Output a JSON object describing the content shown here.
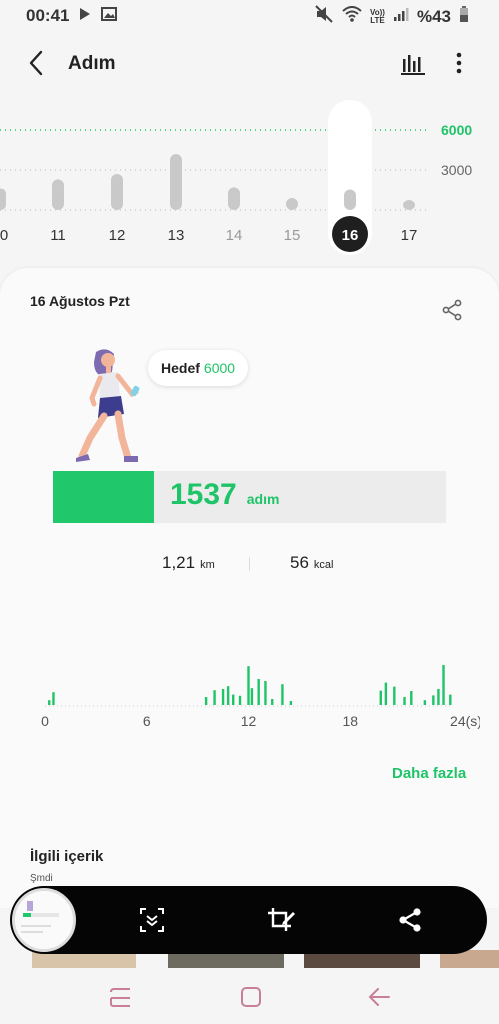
{
  "status_bar": {
    "time": "00:41",
    "network_top": "Vo))",
    "network_bottom": "LTE",
    "battery": "%43",
    "icons": [
      "play-icon",
      "gallery-icon",
      "mute-icon",
      "wifi-icon",
      "volte-icon",
      "signal-icon",
      "battery-icon"
    ]
  },
  "header": {
    "title": "Adım",
    "icons": [
      "back-arrow-icon",
      "bar-chart-icon",
      "more-vert-icon"
    ]
  },
  "day_chart": {
    "goal_label": "6000",
    "mid_label": "3000",
    "days": [
      "0",
      "11",
      "12",
      "13",
      "14",
      "15",
      "16",
      "17"
    ],
    "steps": [
      1600,
      2300,
      2700,
      4200,
      1700,
      900,
      1537,
      0
    ],
    "selected_day": "16",
    "ymax": 6000,
    "colors": {
      "goal": "#1fc468",
      "bar": "#c9c9c9",
      "selected": "#1f1f1f"
    }
  },
  "card": {
    "date": "16 Ağustos Pzt",
    "goal_prefix": "Hedef",
    "goal_value": "6000",
    "steps_value": "1537",
    "steps_unit": "adım",
    "progress": 0.256,
    "distance_value": "1,21",
    "distance_unit": "km",
    "calories_value": "56",
    "calories_unit": "kcal",
    "more_link": "Daha fazla",
    "related_title": "İlgili içerik",
    "related_sub": "Şmdi",
    "accent": "#1fc468"
  },
  "chart_data": {
    "type": "bar",
    "title": "",
    "xlabel": "",
    "ylabel": "",
    "x_ticks": [
      "0",
      "6",
      "12",
      "18",
      "24(s)"
    ],
    "xlim": [
      0,
      24
    ],
    "ylim": [
      0,
      1
    ],
    "x": [
      0.25,
      0.5,
      9.5,
      10.0,
      10.5,
      10.8,
      11.1,
      11.5,
      12.0,
      12.2,
      12.6,
      13.0,
      13.4,
      14.0,
      14.5,
      19.8,
      20.1,
      20.6,
      21.2,
      21.6,
      22.4,
      22.9,
      23.2,
      23.5,
      23.9
    ],
    "values": [
      0.12,
      0.32,
      0.2,
      0.37,
      0.4,
      0.47,
      0.26,
      0.23,
      0.97,
      0.42,
      0.65,
      0.6,
      0.15,
      0.52,
      0.1,
      0.36,
      0.56,
      0.46,
      0.2,
      0.35,
      0.12,
      0.24,
      0.4,
      1.0,
      0.26
    ],
    "color": "#1fc468"
  },
  "toolbar": {
    "icons": [
      "scroll-capture-icon",
      "crop-edit-icon",
      "share-icon"
    ]
  },
  "nav": {
    "icons": [
      "recents-icon",
      "home-icon",
      "back-icon"
    ]
  }
}
